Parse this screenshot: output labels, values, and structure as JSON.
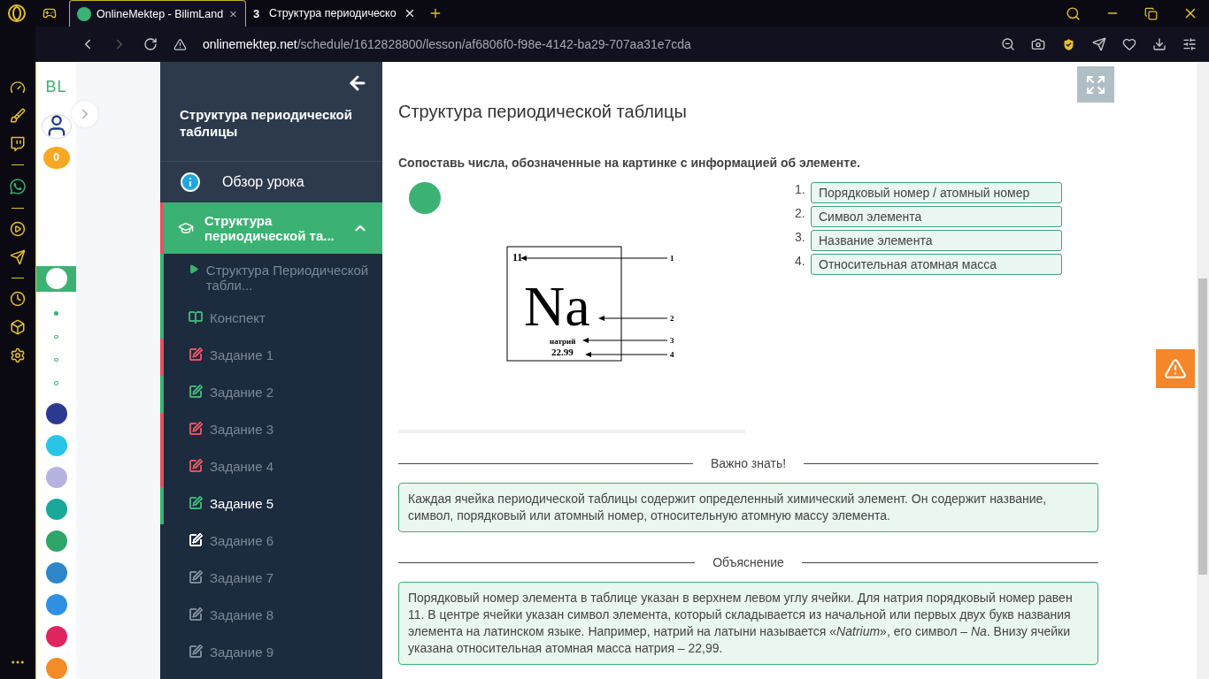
{
  "browser": {
    "tabs": [
      {
        "title": "OnlineMektep - BilimLand",
        "selected": true
      },
      {
        "title": "Структура периодическо",
        "favicon": "3",
        "selected": false
      }
    ],
    "url_host": "onlinemektep.net",
    "url_path": "/schedule/1612828800/lesson/af6806f0-f98e-4142-ba29-707aa31e7cda"
  },
  "app_strip": {
    "logo": "BL",
    "coins": "0",
    "pages": [
      {
        "selected": true
      },
      {
        "selected": false
      },
      {
        "selected": false
      },
      {
        "selected": false
      }
    ],
    "apps": [
      {
        "color": "#2b3a8f"
      },
      {
        "color": "#29c5e6"
      },
      {
        "color": "#b7b3e0"
      },
      {
        "color": "#1aa89a"
      },
      {
        "color": "#2fa56a"
      },
      {
        "color": "#2e86c9"
      },
      {
        "color": "#2f8fe0"
      },
      {
        "color": "#e0245e"
      },
      {
        "color": "#f28c28"
      }
    ]
  },
  "lesson_nav": {
    "title": "Структура периодической таблицы",
    "overview": "Обзор урока",
    "section": {
      "title": "Структура периодической та...",
      "expanded": true
    },
    "items": [
      {
        "kind": "video",
        "label": "Структура Периодической табли...",
        "color": "#3bb273",
        "done": true,
        "selected": false
      },
      {
        "kind": "notes",
        "label": "Конспект",
        "color": "#3bb273",
        "done": true,
        "selected": false
      },
      {
        "kind": "task",
        "label": "Задание 1",
        "color": "#e05260",
        "done": true,
        "selected": false
      },
      {
        "kind": "task",
        "label": "Задание 2",
        "color": "#3bb273",
        "done": true,
        "selected": false
      },
      {
        "kind": "task",
        "label": "Задание 3",
        "color": "#e05260",
        "done": true,
        "selected": false
      },
      {
        "kind": "task",
        "label": "Задание 4",
        "color": "#e05260",
        "done": true,
        "selected": false
      },
      {
        "kind": "task",
        "label": "Задание 5",
        "color": "#3bb273",
        "done": true,
        "selected": true
      },
      {
        "kind": "task",
        "label": "Задание 6",
        "color": "#ffffff",
        "done": false,
        "selected": false
      },
      {
        "kind": "task",
        "label": "Задание 7",
        "color": "#7b8896",
        "done": false,
        "selected": false
      },
      {
        "kind": "task",
        "label": "Задание 8",
        "color": "#7b8896",
        "done": false,
        "selected": false
      },
      {
        "kind": "task",
        "label": "Задание 9",
        "color": "#7b8896",
        "done": false,
        "selected": false
      }
    ]
  },
  "content": {
    "title": "Структура периодической таблицы",
    "instruction": "Сопоставь числа, обозначенные на картинке с информацией об элементе.",
    "element_cell": {
      "number": "11",
      "symbol": "Na",
      "name": "натрий",
      "mass": "22.99",
      "callouts": [
        "1",
        "2",
        "3",
        "4"
      ]
    },
    "answers": [
      {
        "index": "1.",
        "text": "Порядковый номер / атомный номер"
      },
      {
        "index": "2.",
        "text": "Символ элемента"
      },
      {
        "index": "3.",
        "text": "Название элемента"
      },
      {
        "index": "4.",
        "text": "Относительная атомная масса"
      }
    ],
    "important_heading": "Важно знать!",
    "important_text": "Каждая ячейка периодической таблицы содержит определенный химический элемент. Он содержит название, символ, порядковый или атомный номер, относительную атомную массу элемента.",
    "explanation_heading": "Объяснение",
    "explanation_text": "Порядковый номер элемента в таблице указан в верхнем левом углу ячейки. Для натрия порядковый номер равен 11. В центре ячейки указан символ элемента, который складывается из начальной или первых двух букв названия элемента на латинском языке. Например, натрий на латыни называется «*Natrium*», его символ – *Na*. Внизу ячейки указана относительная атомная масса натрия – 22,99."
  }
}
